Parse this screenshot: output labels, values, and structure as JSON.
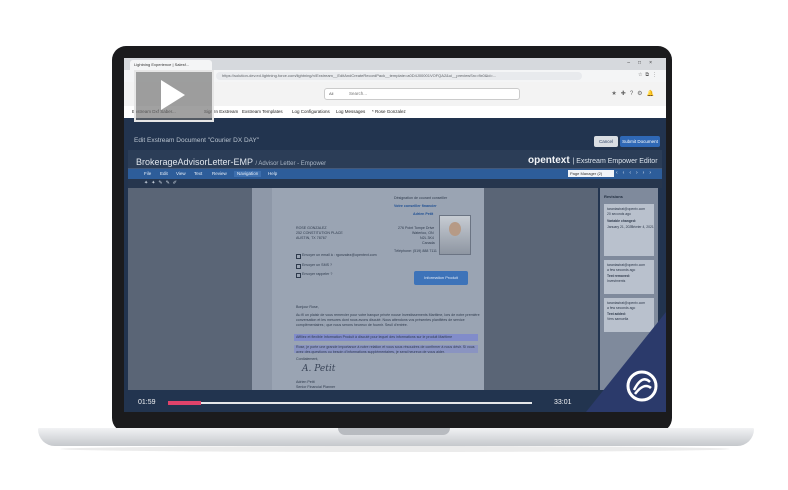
{
  "browser": {
    "tab_title": "Lightning Experience | Salesf...",
    "url": "https://solution-dev.ed.lightning.force.com/lightning/n/Exstream__EditAndCreateRecordPack__template=a0D4J00001VOFQA2&ui__previewSrc=flx0&id=..."
  },
  "sf": {
    "search_scope": "All",
    "search_placeholder": "Search...",
    "nav": [
      "Exstream Dxf Saber...",
      "Sign In Exstream",
      "Exstream Templates",
      "Log Configurations",
      "Log Messages",
      "* Rose Gonzalez"
    ]
  },
  "edit": {
    "title": "Edit Exstream Document \"Courier DX DAY\"",
    "cancel": "Cancel",
    "submit": "Submit Document"
  },
  "doc": {
    "name": "BrokerageAdvisorLetter-EMP",
    "subtitle": "Advisor Letter - Empower"
  },
  "brand": {
    "name": "opentext",
    "tag": "Exstream Empower Editor"
  },
  "menu": [
    "File",
    "Edit",
    "View",
    "Text",
    "Review",
    "Navigation",
    "Help"
  ],
  "page_manager": "Page Manager (2)",
  "letter": {
    "header_small": "Désignation de courant conseiller",
    "header_blue": "Votre conseiller financier",
    "advisor_name": "Adrien Petit",
    "address_lines": [
      "ROSE GONZALEZ",
      "252 CONSTITUTION PLACE",
      "AUSTIN, TX 78767"
    ],
    "advisor_lines": [
      "276 Point Tompe Drive",
      "Waterloo, ON",
      "N2L 3K4",
      "Canada"
    ],
    "phone": "Téléphone: (519) 888 7111",
    "checkboxes": [
      "Envoyer un email à : rgonzalez@opentext.com",
      "Envoyer un SMS ?",
      "Envoyer rappeler ?"
    ],
    "info_button": "Information Produit",
    "greeting": "Bonjour Rose,",
    "para1": "Au fil un plaisir de vous remercier pour votre banque privée nouse Investissements Maritime, lors de notre première",
    "para1b": "conversation et les mesures dont nous avons discuté. Nous attendons vos présentes planifiées de service",
    "para1c": "complémentaires ; que nous serons heureux de fournir. Seuil d'entrée.",
    "hl1": "Affiliez et flexible Information Produit à discuté pour lequel des informations sur le produit Maritime",
    "para2": "Rose, je porte une grande importance à notre relation et vous sous résoudres de confirmer à nous désir. Si vous",
    "para2b": "avez des questions ou besoin d'informations supplémentaires, je serai heureux de vous aider.",
    "closing": "Cordialement,",
    "signer": "Adrien Petit",
    "signer_title": "Senior Financial Planner"
  },
  "revisions": {
    "title": "Revisions",
    "items": [
      {
        "user": "tarantastrat@opentx.com",
        "when": "20 seconds ago",
        "label": "Variable changed:",
        "from": "January 21, 2021",
        "to": "Février 4, 2021"
      },
      {
        "user": "tarantastrat@opentx.com",
        "when": "a few seconds ago",
        "label": "Text removed:",
        "detail": "Investments"
      },
      {
        "user": "tarantastrat@opentx.com",
        "when": "a few seconds ago",
        "label": "Text added:",
        "detail": "Vers samuella"
      }
    ]
  },
  "player": {
    "elapsed": "01:59",
    "duration": "33:01",
    "progress": 0.09
  },
  "colors": {
    "accent": "#e0436b",
    "menubar": "#2d5d9a",
    "submit": "#2f68b6"
  }
}
